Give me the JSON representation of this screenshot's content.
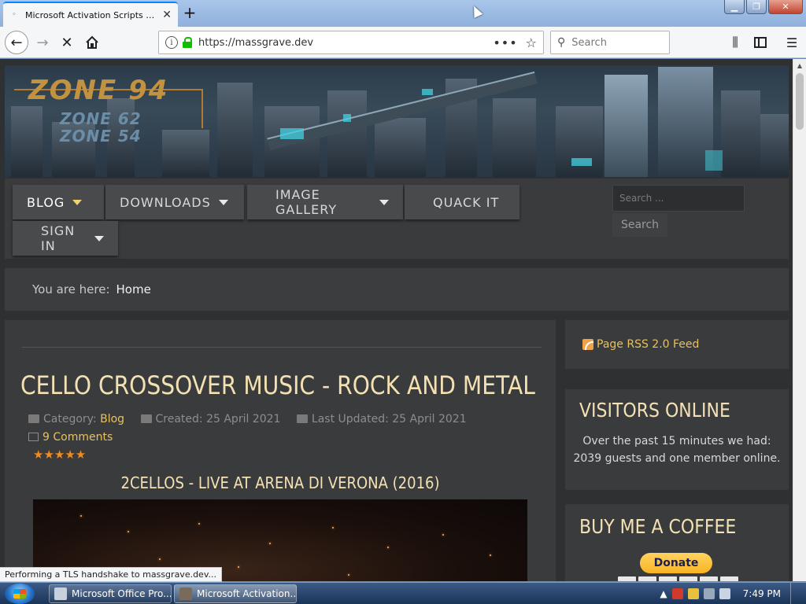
{
  "browser": {
    "tab_title": "Microsoft Activation Scripts (MA",
    "tab_close": "✕",
    "new_tab": "+",
    "url": "https://massgrave.dev",
    "page_actions": "•••",
    "search_placeholder": "Search",
    "status_text": "Performing a TLS handshake to massgrave.dev..."
  },
  "icons": {
    "back": "back-arrow-icon",
    "forward": "forward-arrow-icon",
    "stop": "stop-icon",
    "home": "home-icon",
    "info": "info-icon",
    "lock": "lock-icon",
    "bookmark": "star-icon",
    "library": "library-icon",
    "sidebar": "sidebar-icon",
    "menu": "hamburger-menu-icon"
  },
  "site": {
    "logo": {
      "main": "ZONE 94",
      "sub1": "ZONE 62",
      "sub2": "ZONE 54"
    },
    "menu": [
      {
        "label": "BLOG",
        "has_dropdown": true,
        "active": true
      },
      {
        "label": "DOWNLOADS",
        "has_dropdown": true
      },
      {
        "label": "IMAGE GALLERY",
        "has_dropdown": true
      },
      {
        "label": "QUACK IT",
        "has_dropdown": false
      },
      {
        "label": "SIGN IN",
        "has_dropdown": true
      }
    ],
    "search": {
      "placeholder": "Search ...",
      "button": "Search"
    },
    "breadcrumb": {
      "prefix": "You are here:",
      "current": "Home"
    },
    "article": {
      "title": "CELLO CROSSOVER MUSIC - ROCK AND METAL",
      "category_label": "Category:",
      "category": "Blog",
      "created": "Created: 25 April 2021",
      "updated": "Last Updated: 25 April 2021",
      "comments": "9 Comments",
      "stars": "★★★★★",
      "video_title": "2CELLOS - LIVE AT ARENA DI VERONA (2016)"
    },
    "sidebar": {
      "rss": "Page RSS 2.0 Feed",
      "visitors_title": "VISITORS ONLINE",
      "visitors_text": "Over the past 15 minutes we had: 2039 guests and one member online.",
      "coffee_title": "BUY ME A COFFEE",
      "donate": "Donate"
    }
  },
  "taskbar": {
    "apps": [
      {
        "label": "Microsoft Office Pro..."
      },
      {
        "label": "Microsoft Activation...",
        "active": true
      }
    ],
    "clock": "7:49 PM"
  },
  "colors": {
    "accent_gold": "#e8c160",
    "title_cream": "#f3e1b4",
    "panel_bg": "#3a3b3c",
    "page_bg": "#2f3031",
    "star_orange": "#f08c1e"
  }
}
